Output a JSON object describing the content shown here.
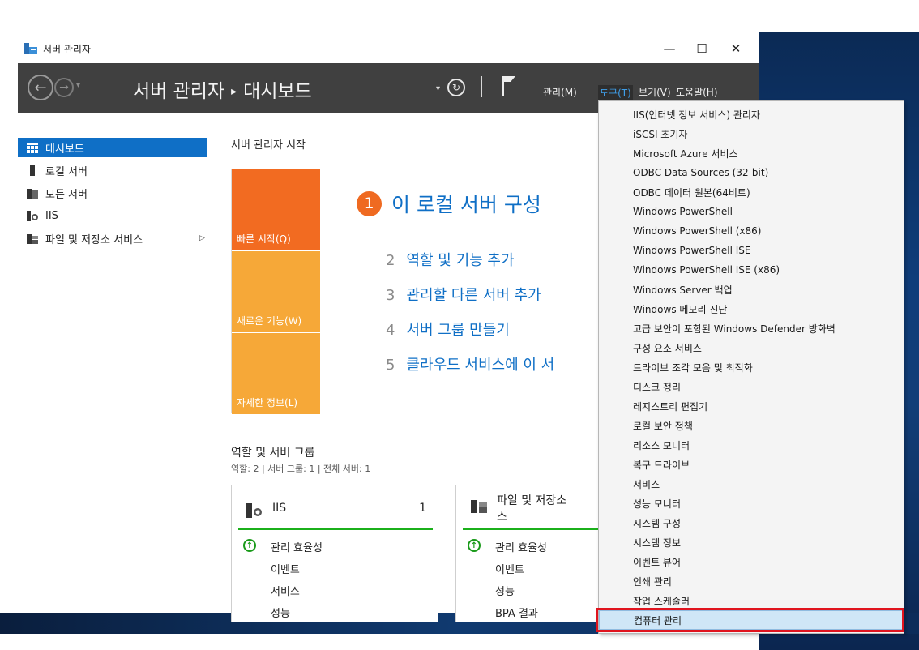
{
  "window": {
    "title": "서버 관리자",
    "minimize": "—",
    "maximize": "☐",
    "close": "✕"
  },
  "toolbar": {
    "breadcrumb_root": "서버 관리자",
    "breadcrumb_sep": "▸",
    "breadcrumb_page": "대시보드",
    "menus": [
      "관리(M)",
      "도구(T)",
      "보기(V)",
      "도움말(H)"
    ],
    "active_menu": "도구(T)"
  },
  "sidebar": {
    "items": [
      {
        "label": "대시보드",
        "icon": "dashboard-icon",
        "selected": true
      },
      {
        "label": "로컬 서버",
        "icon": "server-icon"
      },
      {
        "label": "모든 서버",
        "icon": "servers-icon"
      },
      {
        "label": "IIS",
        "icon": "iis-icon"
      },
      {
        "label": "파일 및 저장소 서비스",
        "icon": "storage-icon",
        "has_children": true
      }
    ]
  },
  "main": {
    "welcome_title": "서버 관리자 시작",
    "tiles": [
      {
        "label": "빠른 시작(Q)",
        "color": "#f26b21"
      },
      {
        "label": "새로운 기능(W)",
        "color": "#f6a838"
      },
      {
        "label": "자세한 정보(L)",
        "color": "#f6a838"
      }
    ],
    "primary_step": {
      "num": "1",
      "text": "이 로컬 서버 구성"
    },
    "steps": [
      {
        "num": "2",
        "text": "역할 및 기능 추가"
      },
      {
        "num": "3",
        "text": "관리할 다른 서버 추가"
      },
      {
        "num": "4",
        "text": "서버 그룹 만들기"
      },
      {
        "num": "5",
        "text": "클라우드 서비스에 이 서"
      }
    ],
    "roles_heading": "역할 및 서버 그룹",
    "roles_summary": "역할: 2   |   서버 그룹: 1   |   전체 서버: 1",
    "cards": [
      {
        "title": "IIS",
        "count": "1",
        "rows": [
          "관리 효율성",
          "이벤트",
          "서비스",
          "성능"
        ]
      },
      {
        "title": "파일 및 저장소 서비스",
        "title_line1": "파일 및 저장소",
        "title_line2": "스",
        "rows": [
          "관리 효율성",
          "이벤트",
          "성능",
          "BPA 결과"
        ]
      }
    ]
  },
  "tools_menu": {
    "items": [
      "IIS(인터넷 정보 서비스) 관리자",
      "iSCSI 초기자",
      "Microsoft Azure 서비스",
      "ODBC Data Sources (32-bit)",
      "ODBC 데이터 원본(64비트)",
      "Windows PowerShell",
      "Windows PowerShell (x86)",
      "Windows PowerShell ISE",
      "Windows PowerShell ISE (x86)",
      "Windows Server 백업",
      "Windows 메모리 진단",
      "고급 보안이 포함된 Windows Defender 방화벽",
      "구성 요소 서비스",
      "드라이브 조각 모음 및 최적화",
      "디스크 정리",
      "레지스트리 편집기",
      "로컬 보안 정책",
      "리소스 모니터",
      "복구 드라이브",
      "서비스",
      "성능 모니터",
      "시스템 구성",
      "시스템 정보",
      "이벤트 뷰어",
      "인쇄 관리",
      "작업 스케줄러",
      "컴퓨터 관리"
    ],
    "highlighted": "컴퓨터 관리"
  },
  "colors": {
    "accent": "#0f6fc6",
    "toolbar": "#404040",
    "quick_start": "#f26b21",
    "tile_light": "#f6a838",
    "status_ok": "#1bb01b",
    "annotation": "#e0141e"
  }
}
